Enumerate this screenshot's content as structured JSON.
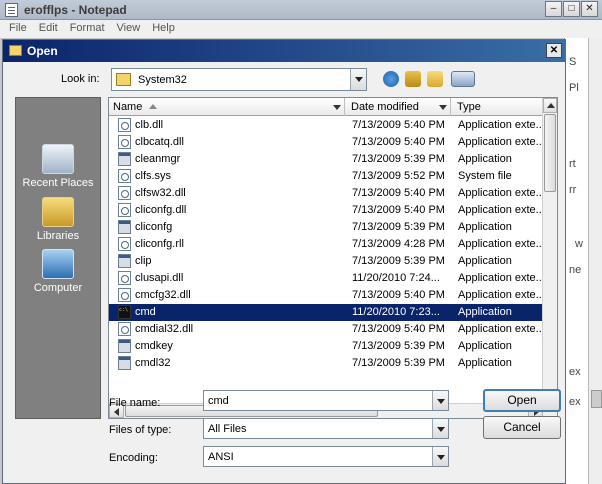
{
  "notepad": {
    "title": "erofflps - Notepad",
    "menu": [
      "File",
      "Edit",
      "Format",
      "View",
      "Help"
    ],
    "bg_text": [
      "S",
      "Pl",
      "rt",
      "rr",
      "w",
      "ne",
      "ex",
      "ex"
    ],
    "controls": [
      "–",
      "□",
      "✕"
    ]
  },
  "dialog": {
    "title": "Open",
    "close_glyph": "✕",
    "look_in_label": "Look in:",
    "look_in_value": "System32",
    "places": [
      {
        "label": "Recent Places",
        "icon": "recent-places-icon"
      },
      {
        "label": "Libraries",
        "icon": "libraries-icon"
      },
      {
        "label": "Computer",
        "icon": "computer-icon"
      }
    ],
    "columns": [
      "Name",
      "Date modified",
      "Type"
    ],
    "files": [
      {
        "name": "clb.dll",
        "date": "7/13/2009 5:40 PM",
        "type": "Application exte...",
        "icon": "gear"
      },
      {
        "name": "clbcatq.dll",
        "date": "7/13/2009 5:40 PM",
        "type": "Application exte...",
        "icon": "gear"
      },
      {
        "name": "cleanmgr",
        "date": "7/13/2009 5:39 PM",
        "type": "Application",
        "icon": "app"
      },
      {
        "name": "clfs.sys",
        "date": "7/13/2009 5:52 PM",
        "type": "System file",
        "icon": "gear"
      },
      {
        "name": "clfsw32.dll",
        "date": "7/13/2009 5:40 PM",
        "type": "Application exte...",
        "icon": "gear"
      },
      {
        "name": "cliconfg.dll",
        "date": "7/13/2009 5:40 PM",
        "type": "Application exte...",
        "icon": "gear"
      },
      {
        "name": "cliconfg",
        "date": "7/13/2009 5:39 PM",
        "type": "Application",
        "icon": "app"
      },
      {
        "name": "cliconfg.rll",
        "date": "7/13/2009 4:28 PM",
        "type": "Application exte...",
        "icon": "gear"
      },
      {
        "name": "clip",
        "date": "7/13/2009 5:39 PM",
        "type": "Application",
        "icon": "app"
      },
      {
        "name": "clusapi.dll",
        "date": "11/20/2010 7:24...",
        "type": "Application exte...",
        "icon": "gear"
      },
      {
        "name": "cmcfg32.dll",
        "date": "7/13/2009 5:40 PM",
        "type": "Application exte...",
        "icon": "gear"
      },
      {
        "name": "cmd",
        "date": "11/20/2010 7:23...",
        "type": "Application",
        "icon": "term",
        "selected": true
      },
      {
        "name": "cmdial32.dll",
        "date": "7/13/2009 5:40 PM",
        "type": "Application exte...",
        "icon": "gear"
      },
      {
        "name": "cmdkey",
        "date": "7/13/2009 5:39 PM",
        "type": "Application",
        "icon": "app"
      },
      {
        "name": "cmdl32",
        "date": "7/13/2009 5:39 PM",
        "type": "Application",
        "icon": "app"
      }
    ],
    "file_name_label": "File name:",
    "file_name_value": "cmd",
    "file_type_label": "Files of type:",
    "file_type_value": "All Files",
    "encoding_label": "Encoding:",
    "encoding_value": "ANSI",
    "open_button": "Open",
    "cancel_button": "Cancel",
    "colors": {
      "selection": "#0a246a",
      "title_gradient_start": "#0a246a",
      "title_gradient_end": "#3a6ea5"
    }
  }
}
